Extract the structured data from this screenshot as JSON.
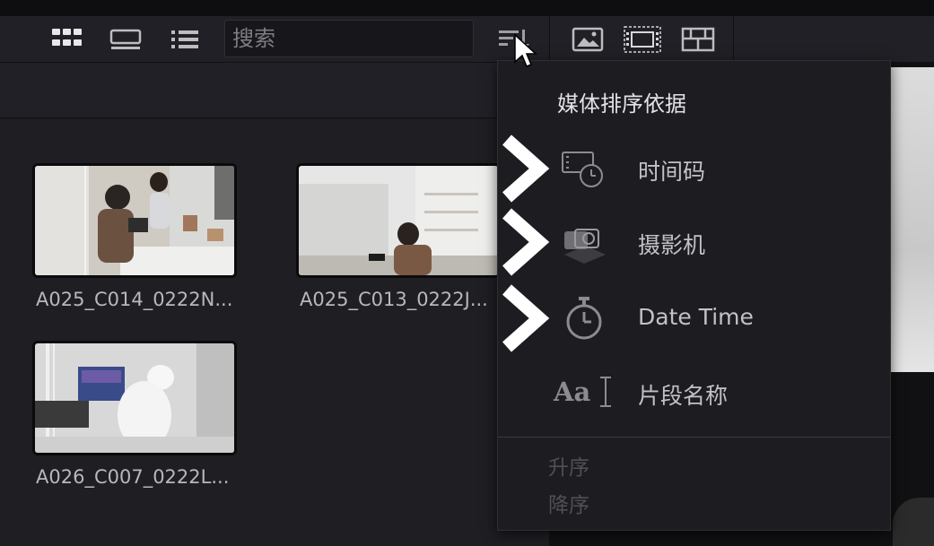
{
  "toolbar": {
    "search_placeholder": "搜索",
    "view_icons": [
      "grid-view-icon",
      "filmstrip-view-icon",
      "list-view-icon"
    ],
    "right_icons": [
      "sort-icon",
      "image-icon",
      "filmstrip-icon",
      "layout-icon"
    ]
  },
  "clips": [
    {
      "name": "A025_C014_0222N..."
    },
    {
      "name": "A025_C013_0222J..."
    },
    {
      "name": "A026_C007_0222L..."
    }
  ],
  "sort_menu": {
    "title": "媒体排序依据",
    "items": [
      {
        "label": "时间码",
        "icon": "timecode-icon"
      },
      {
        "label": "摄影机",
        "icon": "camera-icon"
      },
      {
        "label": "Date Time",
        "icon": "stopwatch-icon"
      },
      {
        "label": "片段名称",
        "icon": "text-cursor-icon",
        "icon_text": "Aa"
      }
    ],
    "ascending": "升序",
    "descending": "降序"
  },
  "colors": {
    "background": "#1b1b20",
    "menu_bg": "#1c1c21",
    "highlight_arrow": "#ffffff"
  }
}
